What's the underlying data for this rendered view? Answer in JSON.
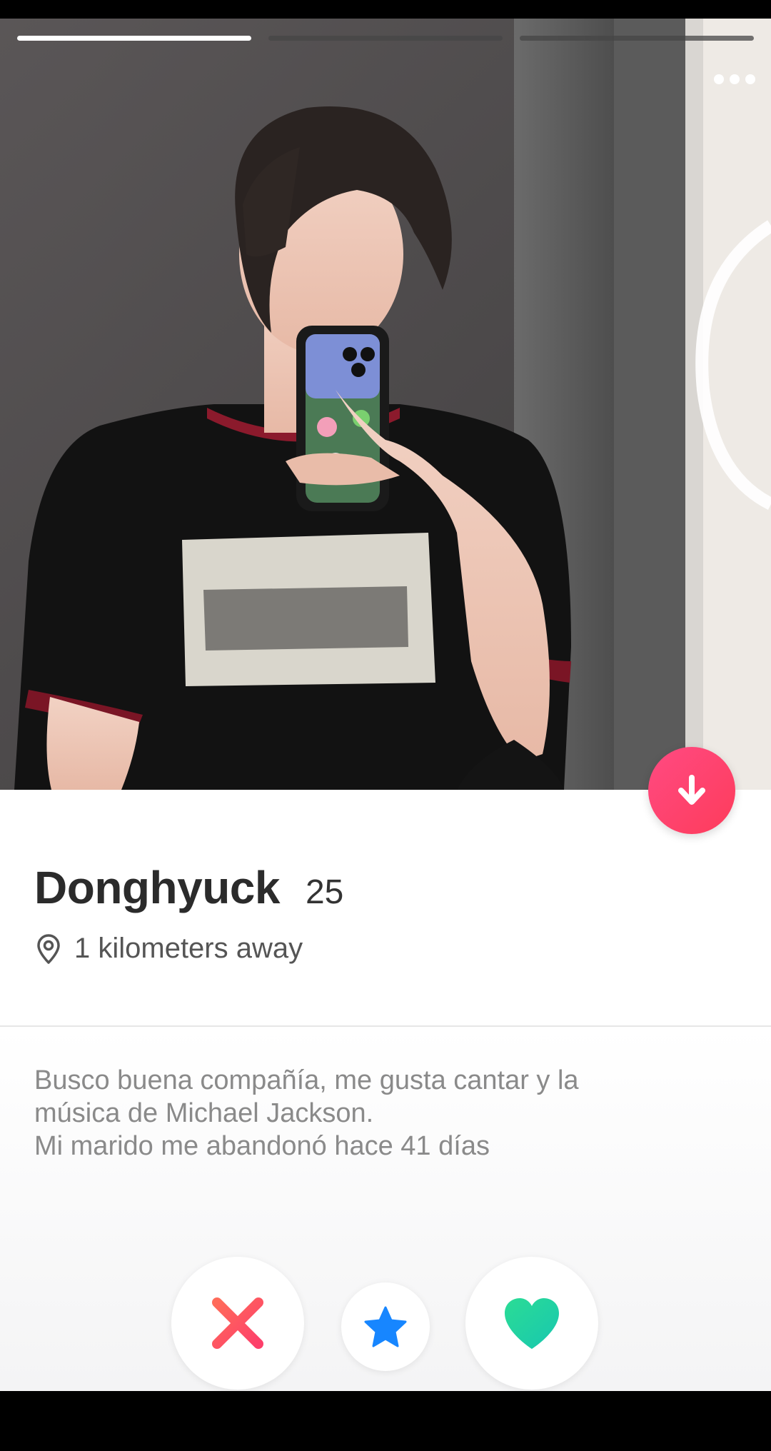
{
  "profile": {
    "name": "Donghyuck",
    "age": "25",
    "distance": "1 kilometers away",
    "bio_lines": [
      "Busco buena compañía, me gusta cantar y la",
      "música de Michael Jackson.",
      "Mi marido me abandonó hace 41 días"
    ]
  },
  "photo": {
    "count": 3,
    "current": 1
  },
  "icons": {
    "more": "more-dots-icon",
    "down": "arrow-down-icon",
    "location": "location-pin-icon",
    "nope": "close-x-icon",
    "super_like": "star-icon",
    "like": "heart-icon"
  },
  "colors": {
    "accent": "#fe3c72",
    "nope": "#fd5068",
    "star": "#1786ff",
    "like": "#1fe0a5"
  }
}
